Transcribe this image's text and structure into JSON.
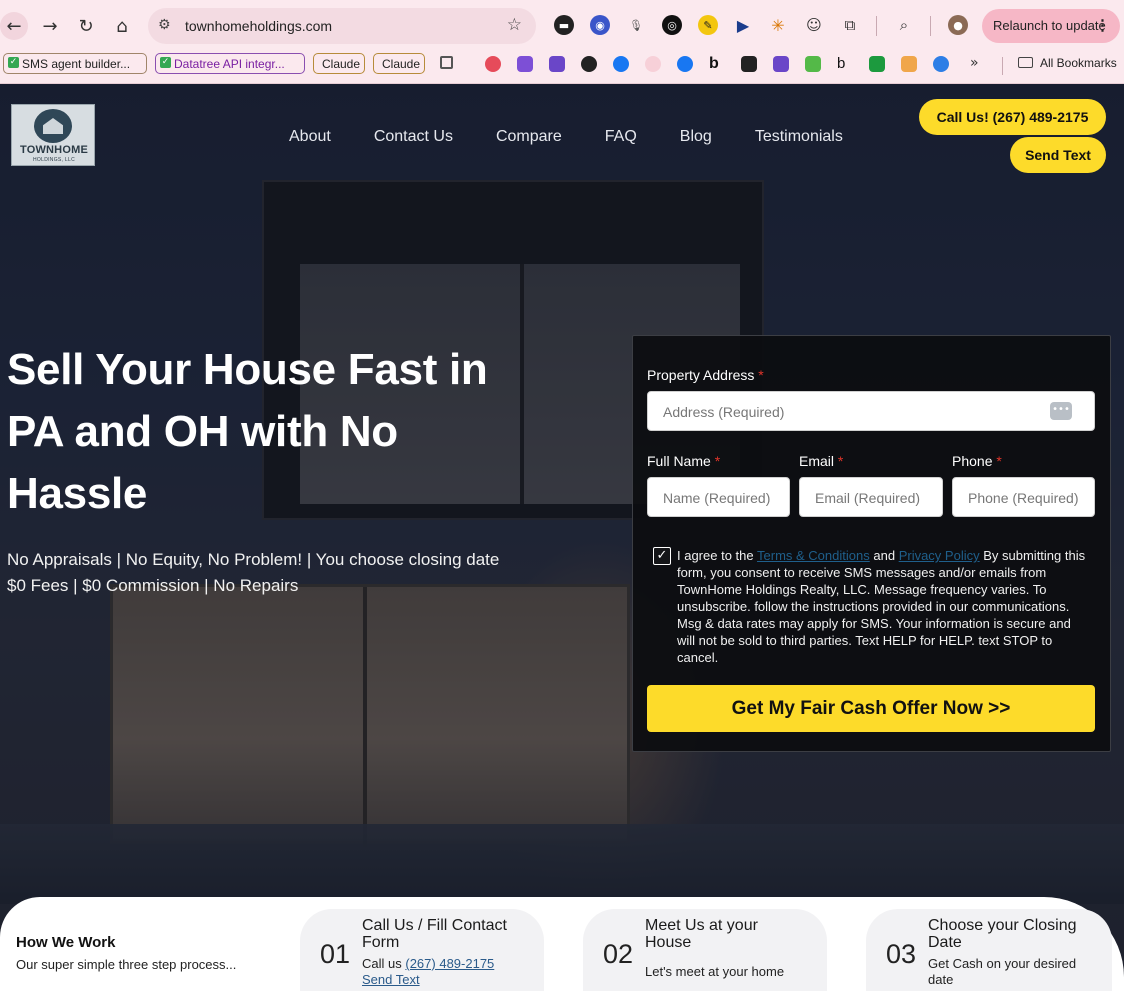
{
  "browser": {
    "url": "townhomeholdings.com",
    "relaunch_label": "Relaunch to update",
    "bookmarks": [
      {
        "label": "SMS agent builder..."
      },
      {
        "label": "Datatree API integr..."
      },
      {
        "label": "Claude"
      },
      {
        "label": "Claude"
      }
    ],
    "all_bookmarks": "All Bookmarks"
  },
  "site": {
    "logo_name": "TOWNHOME",
    "logo_sub": "HOLDINGS, LLC",
    "nav": [
      "About",
      "Contact Us",
      "Compare",
      "FAQ",
      "Blog",
      "Testimonials"
    ],
    "call_button": "Call Us! (267) 489-2175",
    "text_button": "Send Text"
  },
  "hero": {
    "headline": "Sell Your House Fast in PA and OH with No Hassle",
    "line1": "No Appraisals | No Equity, No Problem! | You choose closing date",
    "line2": "$0 Fees | $0 Commission | No Repairs"
  },
  "form": {
    "address_label": "Property Address",
    "address_placeholder": "Address (Required)",
    "name_label": "Full Name",
    "name_placeholder": "Name (Required)",
    "email_label": "Email",
    "email_placeholder": "Email (Required)",
    "phone_label": "Phone",
    "phone_placeholder": "Phone (Required)",
    "required_mark": "*",
    "consent_prefix": "I agree to the",
    "terms_link": "Terms & Conditions",
    "consent_and": "and",
    "privacy_link": "Privacy Policy",
    "consent_rest": "By submitting this form, you consent to receive SMS messages and/or emails from TownHome Holdings Realty, LLC. Message frequency varies. To unsubscribe. follow the instructions provided in our communications. Msg & data rates may apply for SMS. Your information is secure and will not be sold to third parties. Text HELP for HELP. text STOP to cancel.",
    "consent_checked": true,
    "submit_label": "Get My Fair Cash Offer Now >>"
  },
  "how_we_work": {
    "title": "How We Work",
    "subtitle": "Our super simple three step process...",
    "steps": [
      {
        "num": "01",
        "title": "Call Us / Fill Contact Form",
        "body_prefix": "Call us",
        "phone_link": "(267) 489-2175",
        "text_link": "Send Text"
      },
      {
        "num": "02",
        "title": "Meet Us at your House",
        "body": "Let's meet at your home"
      },
      {
        "num": "03",
        "title": "Choose your Closing Date",
        "body": "Get Cash on your desired date"
      }
    ]
  }
}
